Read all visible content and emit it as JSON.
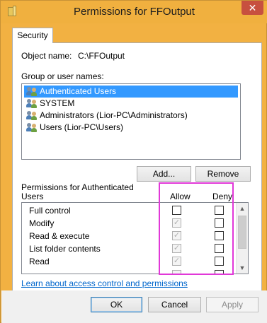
{
  "window": {
    "title": "Permissions for FFOutput",
    "close_label": "✕"
  },
  "tabs": [
    {
      "label": "Security"
    }
  ],
  "object": {
    "label": "Object name:",
    "value": "C:\\FFOutput"
  },
  "groups": {
    "label": "Group or user names:",
    "items": [
      {
        "label": "Authenticated Users",
        "selected": true
      },
      {
        "label": "SYSTEM",
        "selected": false
      },
      {
        "label": "Administrators (Lior-PC\\Administrators)",
        "selected": false
      },
      {
        "label": "Users (Lior-PC\\Users)",
        "selected": false
      }
    ]
  },
  "buttons": {
    "add": "Add...",
    "remove": "Remove",
    "ok": "OK",
    "cancel": "Cancel",
    "apply": "Apply"
  },
  "permissions": {
    "label_line1": "Permissions for Authenticated",
    "label_line2": "Users",
    "allow_header": "Allow",
    "deny_header": "Deny",
    "rows": [
      {
        "name": "Full control",
        "allow": false,
        "deny": false
      },
      {
        "name": "Modify",
        "allow": true,
        "deny": false
      },
      {
        "name": "Read & execute",
        "allow": true,
        "deny": false
      },
      {
        "name": "List folder contents",
        "allow": true,
        "deny": false
      },
      {
        "name": "Read",
        "allow": true,
        "deny": false
      }
    ],
    "checkmark": "✓"
  },
  "link": {
    "label": "Learn about access control and permissions"
  },
  "colors": {
    "titlebar": "#f0b03f",
    "selection": "#3399ff",
    "highlight": "#e138d8",
    "link": "#0066cc"
  }
}
